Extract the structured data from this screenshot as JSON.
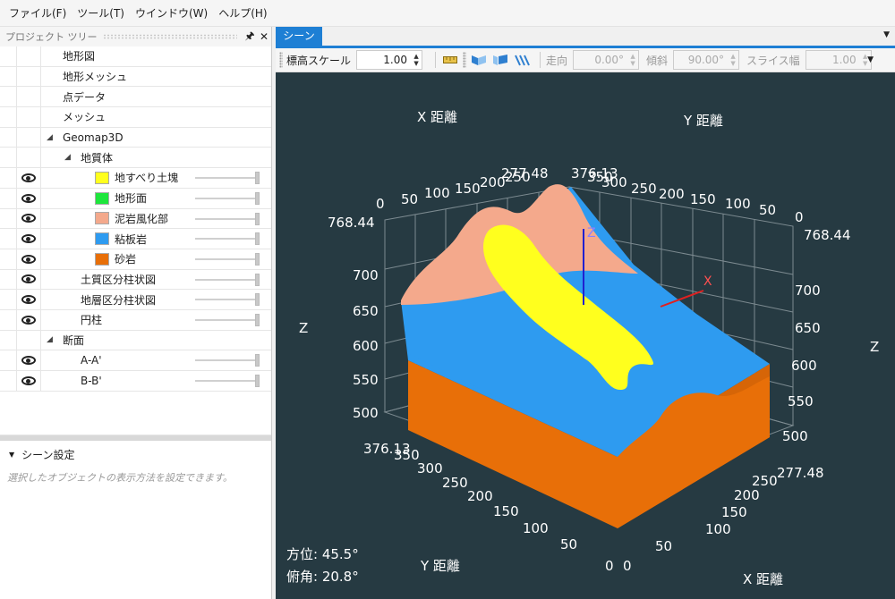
{
  "menu": [
    "ファイル(F)",
    "ツール(T)",
    "ウインドウ(W)",
    "ヘルプ(H)"
  ],
  "project_tree": {
    "title": "プロジェクト ツリー",
    "items": [
      {
        "label": "地形図",
        "indent": 0,
        "eye": false
      },
      {
        "label": "地形メッシュ",
        "indent": 0,
        "eye": false
      },
      {
        "label": "点データ",
        "indent": 0,
        "eye": false
      },
      {
        "label": "メッシュ",
        "indent": 0,
        "eye": false
      },
      {
        "label": "Geomap3D",
        "indent": 0,
        "eye": false,
        "expanded": true
      },
      {
        "label": "地質体",
        "indent": 1,
        "eye": false,
        "expanded": true
      },
      {
        "label": "地すべり土塊",
        "indent": 2,
        "eye": true,
        "color": "#ffff1e",
        "slider": 1.0
      },
      {
        "label": "地形面",
        "indent": 2,
        "eye": true,
        "color": "#1ee63c",
        "slider": 1.0
      },
      {
        "label": "泥岩風化部",
        "indent": 2,
        "eye": true,
        "color": "#f4a98c",
        "slider": 1.0
      },
      {
        "label": "粘板岩",
        "indent": 2,
        "eye": true,
        "color": "#2e9bf0",
        "slider": 1.0
      },
      {
        "label": "砂岩",
        "indent": 2,
        "eye": true,
        "color": "#e86f08",
        "slider": 1.0
      },
      {
        "label": "土質区分柱状図",
        "indent": 1,
        "eye": true,
        "slider": 1.0
      },
      {
        "label": "地層区分柱状図",
        "indent": 1,
        "eye": true,
        "slider": 1.0
      },
      {
        "label": "円柱",
        "indent": 1,
        "eye": true,
        "slider": 1.0
      },
      {
        "label": "断面",
        "indent": 0,
        "eye": false,
        "expanded": true
      },
      {
        "label": "A-A'",
        "indent": 1,
        "eye": true,
        "slider": 1.0
      },
      {
        "label": "B-B'",
        "indent": 1,
        "eye": true,
        "slider": 1.0
      }
    ]
  },
  "scene_settings": {
    "title": "シーン設定",
    "description": "選択したオブジェクトの表示方法を設定できます。"
  },
  "tab": {
    "label": "シーン"
  },
  "toolbar": {
    "elevation_scale_label": "標高スケール",
    "elevation_scale_value": "1.00",
    "strike_label": "走向",
    "strike_value": "0.00°",
    "dip_label": "傾斜",
    "dip_value": "90.00°",
    "slice_label": "スライス幅",
    "slice_value": "1.00"
  },
  "viewport": {
    "azimuth": "方位: 45.5°",
    "elevation": "俯角: 20.8°",
    "axis_titles": {
      "x_top": "X 距離",
      "y_top": "Y 距離",
      "z_left": "Z",
      "z_right": "Z",
      "y_bottom": "Y 距離",
      "x_bottom": "X 距離"
    },
    "z_ticks": [
      "768.44",
      "700",
      "650",
      "600",
      "550",
      "500"
    ],
    "top_x_ticks": [
      "0",
      "50",
      "100",
      "150",
      "200",
      "250"
    ],
    "top_y_ticks": [
      "350",
      "300",
      "250",
      "200",
      "150",
      "100",
      "50",
      "0"
    ],
    "bottom_y_ticks": [
      "376.13",
      "350",
      "300",
      "250",
      "200",
      "150",
      "100",
      "50",
      "0"
    ],
    "bottom_x_ticks": [
      "0",
      "50",
      "100",
      "150",
      "200",
      "250",
      "277.48"
    ],
    "top_x_max": "277.48",
    "top_y_max": "376.13",
    "axis_marker_x": "X",
    "axis_marker_z": "Z",
    "colors": {
      "background": "#263a42",
      "landslide": "#ffff1e",
      "mudstone": "#f4a98c",
      "slate": "#2e9bf0",
      "sandstone": "#e86f08"
    }
  }
}
